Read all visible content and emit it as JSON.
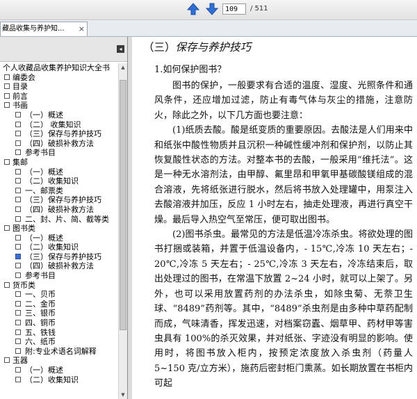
{
  "toolbar": {
    "page_current": "109",
    "page_total": "/ 511",
    "prev_icon": "up-arrow-icon",
    "next_icon": "down-arrow-icon"
  },
  "tab": {
    "title": "藏品收集与养护知...",
    "close_label": "×"
  },
  "sidebar": {
    "collapse_label": "◂",
    "items": [
      {
        "label": "个人收藏品收集养护知识大全书",
        "level": 0,
        "box": false
      },
      {
        "label": "编委会",
        "level": 1
      },
      {
        "label": "目录",
        "level": 1
      },
      {
        "label": "前言",
        "level": 1
      },
      {
        "label": "书画",
        "level": 1
      },
      {
        "label": "（一）概述",
        "level": 2
      },
      {
        "label": "（二） 收集知识",
        "level": 2
      },
      {
        "label": "（三）保存与养护技巧",
        "level": 2
      },
      {
        "label": "（四）破损补救方法",
        "level": 2
      },
      {
        "label": "参考书目",
        "level": 2
      },
      {
        "label": "集邮",
        "level": 1
      },
      {
        "label": "（一）概述",
        "level": 2
      },
      {
        "label": "（二）收集知识",
        "level": 2
      },
      {
        "label": "一、邮票类",
        "level": 2
      },
      {
        "label": "（三）保存与养护技巧",
        "level": 2
      },
      {
        "label": "（四）破损补救方法",
        "level": 2
      },
      {
        "label": "二、封、片、简、截等类",
        "level": 2
      },
      {
        "label": "图书类",
        "level": 1
      },
      {
        "label": "（一）概述",
        "level": 2
      },
      {
        "label": "（二）收集知识",
        "level": 2
      },
      {
        "label": "（三）保存与养护技巧",
        "level": 2,
        "selected": true
      },
      {
        "label": "（四）破损补救方法",
        "level": 2
      },
      {
        "label": "参考书目",
        "level": 2
      },
      {
        "label": "货币类",
        "level": 1
      },
      {
        "label": "一、贝币",
        "level": 2
      },
      {
        "label": "二、金币",
        "level": 2
      },
      {
        "label": "三、银币",
        "level": 2
      },
      {
        "label": "四、铜币",
        "level": 2
      },
      {
        "label": "五、铁钱",
        "level": 2
      },
      {
        "label": "六、纸币",
        "level": 2
      },
      {
        "label": "附:专业术语名词解释",
        "level": 2
      },
      {
        "label": "玉器",
        "level": 1
      },
      {
        "label": "（一）概述",
        "level": 2
      },
      {
        "label": "（二）收集知识",
        "level": 2
      }
    ]
  },
  "content": {
    "section_prefix": "（三）",
    "section_title": "保存与养护技巧",
    "question": "1.如何保护图书？",
    "paragraphs": [
      "图书的保护，一般要求有合适的温度、湿度、光照条件和通风条件，还应增加过滤，防止有毒气体与灰尘的措施，注意防火，除此之外，以下几方面也要注意：",
      "(1)纸质去酸。酸是纸变质的重要原因。去酸法是人们用来中和纸张中酸性物质并且沉积一种碱性缓冲剂和保护剂，以防止其恢复酸性状态的方法。对整本书的去酸，一般采用“维托法”。这是一种无水溶剂法，由甲醇、氟里昂和甲氧甲基碳酸镁组成的混合溶液，先将纸张进行脱水，然后将书放入处理罐中，用泵注入去酸溶液并加压，反应 1 小时左右，抽走处理液，再进行真空干燥。最后导入热空气至常压，便可取出图书。",
      "(2)图书杀虫。最常见的方法是低温冷冻杀虫。将欲处理的图书打捆或装箱，并置于低温设备内，- 15℃,冷冻 10 天左右；- 20℃,冷冻 5 天左右；- 25℃,冷冻 3 天左右，冷冻结束后，取出处理过的图书，在常温下放置 2~24 小时，就可以上架了。另外，也可以采用放置药剂的办法杀虫，如除虫菊、无萘卫生球、“8489”药剂等。其中，“8489”杀虫剂是由多种中草药配制而成，气味清香，挥发迅速，对档案窃蠹、烟草甲、药材甲等害虫具有 100%的杀灭效果，并对纸张、字迹没有明显的影响。使用时，将图书放入柜内，按预定浓度放入杀虫剂（药量人 5~150 克/立方米），施药后密封柜门熏蒸。如长期放置在书柜内可起"
    ]
  },
  "colors": {
    "arrow_blue": "#2f6fd8",
    "selected_box": "#3d6fd6"
  }
}
